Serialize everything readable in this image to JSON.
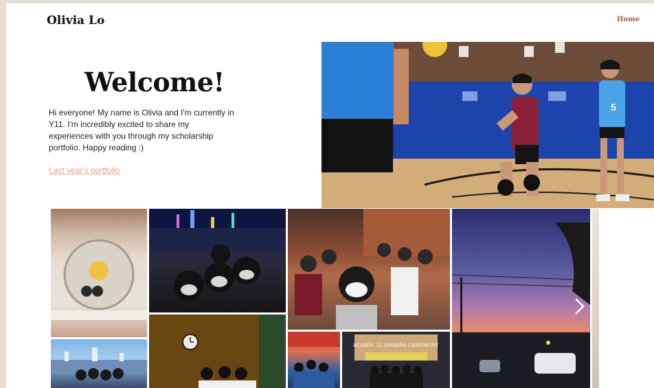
{
  "header": {
    "site_title": "Olivia Lo",
    "nav_home": "Home"
  },
  "hero": {
    "heading": "Welcome!",
    "intro": "Hi everyone! My name is Olivia and I'm currently in Y11. I'm incredibly excited to share my experiences with you through my scholarship portfolio. Happy reading :)",
    "link_label": "Last year's portfolio"
  },
  "gallery": {
    "photos": [
      "bathroom-mirror-selfie",
      "night-harbour-group-selfie",
      "restaurant-group-selfie",
      "sunset-street",
      "partial-photo",
      "harbour-group-photo",
      "clock-room-group",
      "festival-group",
      "awards-ceremony-group"
    ],
    "banner_text": "ACAMIS '22 AWARDS CEREMONY",
    "next_icon": "chevron-right-icon"
  },
  "colors": {
    "accent": "#b5553e",
    "link": "#e0a58f",
    "background": "#e7ded5"
  }
}
